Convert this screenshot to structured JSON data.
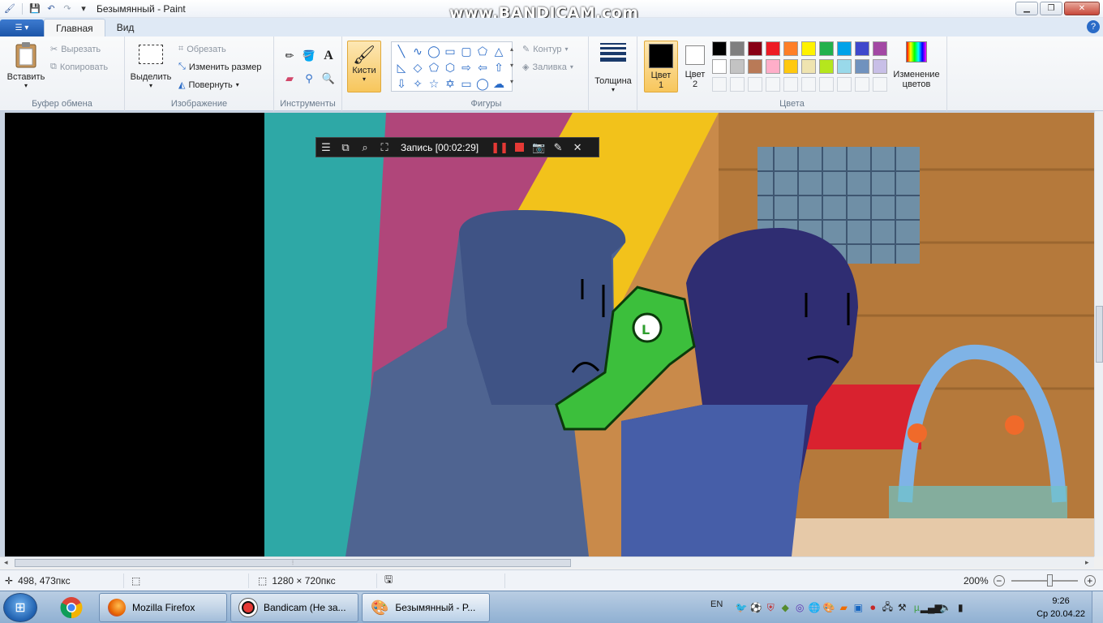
{
  "window": {
    "title": "Безымянный - Paint",
    "watermark": "www.BANDICAM.com"
  },
  "tabs": [
    {
      "label": "Главная",
      "active": true
    },
    {
      "label": "Вид",
      "active": false
    }
  ],
  "ribbon": {
    "clipboard": {
      "label": "Буфер обмена",
      "paste": "Вставить",
      "cut": "Вырезать",
      "copy": "Копировать"
    },
    "image": {
      "label": "Изображение",
      "select": "Выделить",
      "crop": "Обрезать",
      "resize": "Изменить размер",
      "rotate": "Повернуть"
    },
    "tools": {
      "label": "Инструменты"
    },
    "brushes": {
      "label": "Кисти"
    },
    "shapes": {
      "label": "Фигуры",
      "outline": "Контур",
      "fill": "Заливка"
    },
    "size": {
      "label": "Толщина"
    },
    "colors": {
      "label": "Цвета",
      "color1_line1": "Цвет",
      "color1_line2": "1",
      "color2_line1": "Цвет",
      "color2_line2": "2",
      "edit_line1": "Изменение",
      "edit_line2": "цветов",
      "color1_value": "#000000",
      "color2_value": "#ffffff",
      "palette_row1": [
        "#000000",
        "#7f7f7f",
        "#880015",
        "#ed1c24",
        "#ff7f27",
        "#fff200",
        "#22b14c",
        "#00a2e8",
        "#3f48cc",
        "#a349a4"
      ],
      "palette_row2": [
        "#ffffff",
        "#c3c3c3",
        "#b97a57",
        "#ffaec9",
        "#ffc90e",
        "#efe4b0",
        "#b5e61d",
        "#99d9ea",
        "#7092be",
        "#c8bfe7"
      ]
    }
  },
  "bandicam": {
    "recording_label": "Запись [00:02:29]"
  },
  "status": {
    "cursor_pos": "498, 473пкс",
    "image_size": "1280 × 720пкс",
    "zoom": "200%"
  },
  "taskbar": {
    "tasks": [
      {
        "label": "Mozilla Firefox"
      },
      {
        "label": "Bandicam (Не за..."
      },
      {
        "label": "Безымянный - P..."
      }
    ],
    "language": "EN",
    "time": "9:26",
    "date": "Ср 20.04.22"
  }
}
